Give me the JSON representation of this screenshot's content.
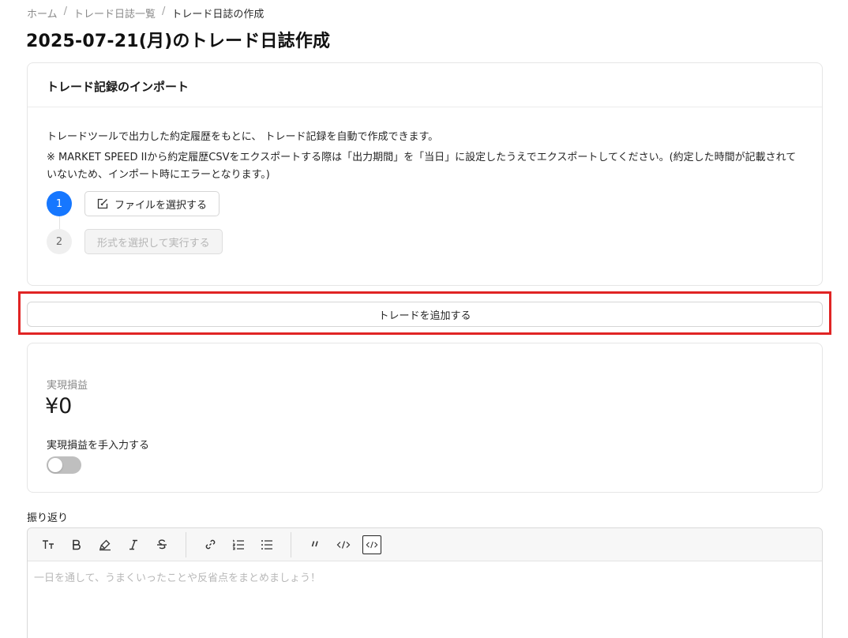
{
  "breadcrumb": {
    "items": [
      "ホーム",
      "トレード日誌一覧",
      "トレード日誌の作成"
    ],
    "separator": "/"
  },
  "page_title": "2025-07-21(月)のトレード日誌作成",
  "import_card": {
    "title": "トレード記録のインポート",
    "description": "トレードツールで出力した約定履歴をもとに、 トレード記録を自動で作成できます。",
    "note": "※ MARKET SPEED IIから約定履歴CSVをエクスポートする際は「出力期間」を「当日」に設定したうえでエクスポートしてください。(約定した時間が記載されていないため、インポート時にエラーとなります。)",
    "steps": [
      {
        "number": "1",
        "label": "ファイルを選択する",
        "icon": "edit-icon",
        "enabled": true
      },
      {
        "number": "2",
        "label": "形式を選択して実行する",
        "enabled": false
      }
    ]
  },
  "add_trade_label": "トレードを追加する",
  "pnl": {
    "label": "実現損益",
    "value": "¥0",
    "manual_label": "実現損益を手入力する",
    "manual_enabled": false
  },
  "review": {
    "label": "振り返り",
    "placeholder": "一日を通して、うまくいったことや反省点をまとめましょう！",
    "toolbar": [
      "text-size-icon",
      "bold-icon",
      "highlight-icon",
      "italic-icon",
      "strikethrough-icon",
      "link-icon",
      "ordered-list-icon",
      "bullet-list-icon",
      "quote-icon",
      "code-icon",
      "code-block-icon"
    ]
  },
  "colors": {
    "primary": "#1677ff",
    "highlight_frame": "#e02424",
    "toggle_off": "#bfbfbf"
  }
}
